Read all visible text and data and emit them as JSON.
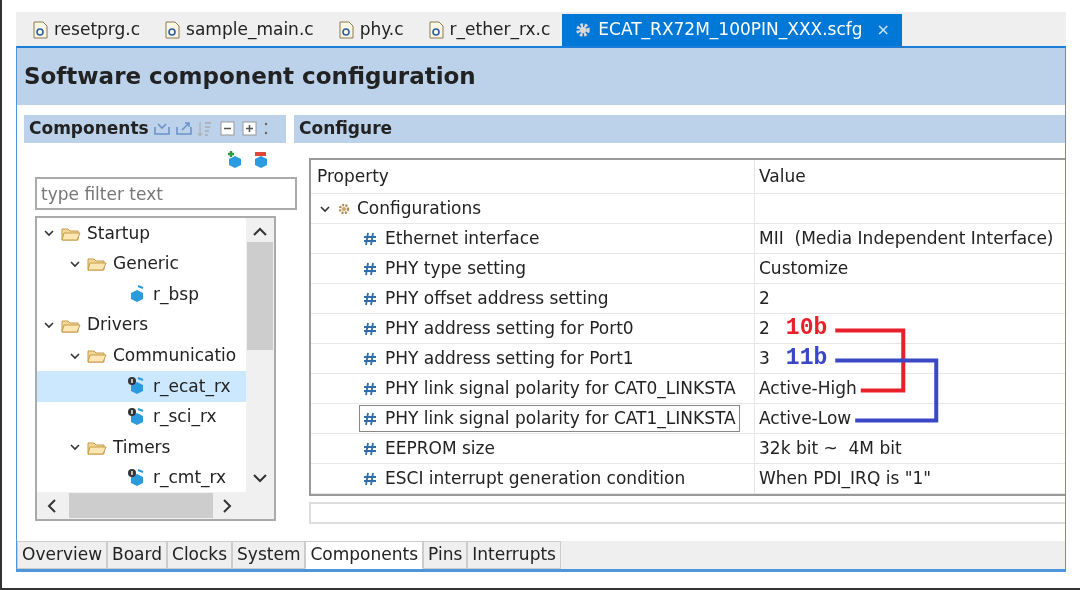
{
  "editor_tabs": [
    {
      "label": "resetprg.c",
      "kind": "c-file",
      "selected": false
    },
    {
      "label": "sample_main.c",
      "kind": "c-file",
      "selected": false
    },
    {
      "label": "phy.c",
      "kind": "c-file",
      "selected": false
    },
    {
      "label": "r_ether_rx.c",
      "kind": "c-file",
      "selected": false
    },
    {
      "label": "ECAT_RX72M_100PIN_XXX.scfg",
      "kind": "config",
      "selected": true,
      "close": "×"
    }
  ],
  "title": "Software component configuration",
  "components_panel": {
    "title": "Components",
    "filter": {
      "placeholder": "type filter text"
    },
    "tree": [
      {
        "label": "Startup",
        "kind": "folder",
        "expanded": true,
        "selected": false,
        "children": [
          {
            "label": "Generic",
            "kind": "folder",
            "expanded": true,
            "selected": false,
            "children": [
              {
                "label": "r_bsp",
                "kind": "component",
                "selected": false
              }
            ]
          }
        ]
      },
      {
        "label": "Drivers",
        "kind": "folder",
        "expanded": true,
        "selected": false,
        "children": [
          {
            "label": "Communicatio",
            "kind": "folder",
            "expanded": true,
            "selected": false,
            "children": [
              {
                "label": "r_ecat_rx",
                "kind": "component-config",
                "selected": true
              },
              {
                "label": "r_sci_rx",
                "kind": "component-config",
                "selected": false
              }
            ]
          },
          {
            "label": "Timers",
            "kind": "folder",
            "expanded": true,
            "selected": false,
            "children": [
              {
                "label": "r_cmt_rx",
                "kind": "component-config",
                "selected": false
              }
            ]
          }
        ]
      }
    ]
  },
  "configure_panel": {
    "title": "Configure",
    "columns": [
      "Property",
      "Value"
    ],
    "rows": [
      {
        "label": "Configurations",
        "expanded": true,
        "children": [
          {
            "property": "Ethernet interface",
            "value": "MII  (Media Independent Interface)",
            "selected": false
          },
          {
            "property": "PHY type setting",
            "value": "Customize",
            "selected": false
          },
          {
            "property": "PHY offset address setting",
            "value": "2",
            "selected": false
          },
          {
            "property": "PHY address setting for Port0",
            "value": "2",
            "selected": false,
            "note": {
              "text": "10b",
              "color": "#e8202a"
            }
          },
          {
            "property": "PHY address setting for Port1",
            "value": "3",
            "selected": false,
            "note": {
              "text": "11b",
              "color": "#3a48c8"
            }
          },
          {
            "property": "PHY link signal polarity for CAT0_LINKSTA",
            "value": "Active-High",
            "selected": false,
            "connector_end": true
          },
          {
            "property": "PHY link signal polarity for CAT1_LINKSTA",
            "value": "Active-Low",
            "selected": true,
            "connector_end": true
          },
          {
            "property": "EEPROM size",
            "value": "32k bit ~  4M bit",
            "selected": false
          },
          {
            "property": "ESCI interrupt generation condition",
            "value": "When PDI_IRQ is \"1\"",
            "selected": false
          }
        ]
      }
    ]
  },
  "bottom_tabs": [
    {
      "label": "Overview",
      "selected": false
    },
    {
      "label": "Board",
      "selected": false
    },
    {
      "label": "Clocks",
      "selected": false
    },
    {
      "label": "System",
      "selected": false
    },
    {
      "label": "Components",
      "selected": true
    },
    {
      "label": "Pins",
      "selected": false
    },
    {
      "label": "Interrupts",
      "selected": false
    }
  ]
}
